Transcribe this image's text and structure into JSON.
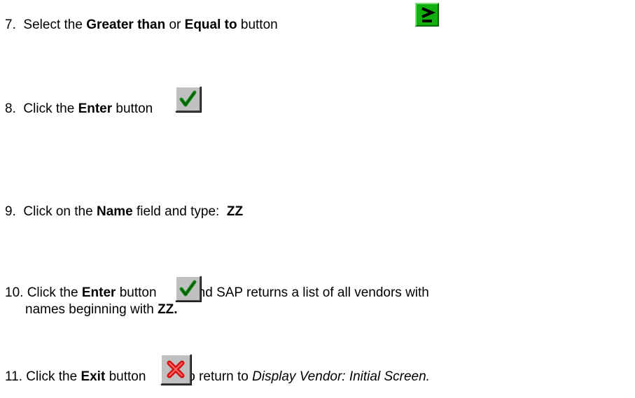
{
  "steps": [
    {
      "num": "7.",
      "pre": "Select the ",
      "b1": "Greater than",
      "mid": " or ",
      "b2": "Equal to",
      "post": " button"
    },
    {
      "num": "8.",
      "pre": "Click the ",
      "b1": "Enter",
      "post": " button"
    },
    {
      "num": "9.",
      "pre": "Click on the ",
      "b1": "Name",
      "post": " field and type:  ",
      "b2": "ZZ"
    },
    {
      "num": "10.",
      "pre": "Click the ",
      "b1": "Enter",
      "post": " button ",
      "post2": " and SAP returns a list of all vendors with",
      "line2a": "names beginning with ",
      "line2b": "ZZ."
    },
    {
      "num": "11.",
      "pre": "Click the ",
      "b1": "Exit",
      "post": " button ",
      "post2": " to return to ",
      "italic": "Display Vendor: Initial Screen."
    }
  ],
  "icons": {
    "ge": "greater-equal-icon",
    "enter": "checkmark-icon",
    "exit": "red-x-icon"
  }
}
